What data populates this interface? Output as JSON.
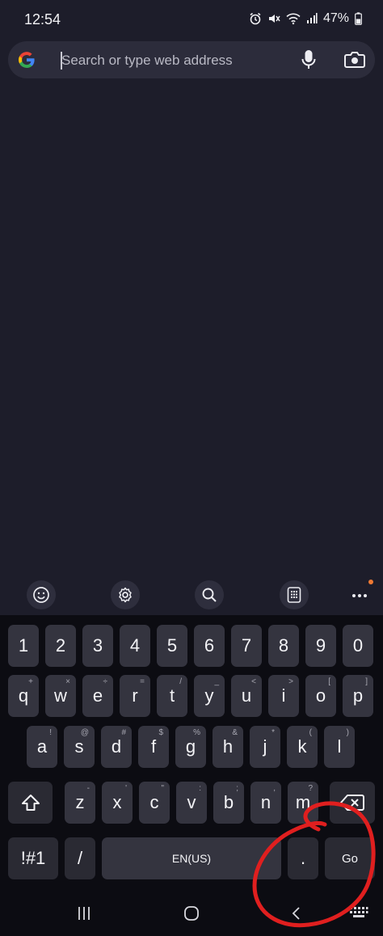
{
  "status_bar": {
    "time": "12:54",
    "battery_percent": "47%",
    "icons": [
      "alarm-icon",
      "mute-icon",
      "wifi-icon",
      "signal-icon",
      "battery-icon"
    ]
  },
  "search": {
    "placeholder": "Search or type web address",
    "value": "",
    "icons": [
      "google-g-icon",
      "microphone-icon",
      "camera-icon"
    ]
  },
  "keyboard_toolbar": {
    "items": [
      "emoji-icon",
      "settings-icon",
      "search-icon",
      "keypad-icon",
      "more-icon"
    ]
  },
  "keyboard": {
    "numbers": [
      "1",
      "2",
      "3",
      "4",
      "5",
      "6",
      "7",
      "8",
      "9",
      "0"
    ],
    "row1": {
      "keys": [
        "q",
        "w",
        "e",
        "r",
        "t",
        "y",
        "u",
        "i",
        "o",
        "p"
      ],
      "hints": [
        "+",
        "×",
        "÷",
        "=",
        "/",
        "_",
        "<",
        ">",
        "[",
        "]"
      ]
    },
    "row2": {
      "keys": [
        "a",
        "s",
        "d",
        "f",
        "g",
        "h",
        "j",
        "k",
        "l"
      ],
      "hints": [
        "!",
        "@",
        "#",
        "$",
        "%",
        "&",
        "*",
        "(",
        ")"
      ]
    },
    "row3": {
      "keys": [
        "z",
        "x",
        "c",
        "v",
        "b",
        "n",
        "m"
      ],
      "hints": [
        "-",
        "'",
        "\"",
        ":",
        ";",
        ",",
        "?"
      ]
    },
    "symbols_label": "!#1",
    "slash_label": "/",
    "space_label": "EN(US)",
    "period_label": ".",
    "go_label": "Go"
  },
  "navigation": {
    "items": [
      "recents-icon",
      "home-icon",
      "back-icon",
      "keyboard-hide-icon"
    ]
  },
  "colors": {
    "background": "#1d1d2a",
    "keyboard_background": "#0c0c12",
    "key": "#34343f",
    "annotation": "#e01f1f",
    "notification_dot": "#f07a33"
  }
}
